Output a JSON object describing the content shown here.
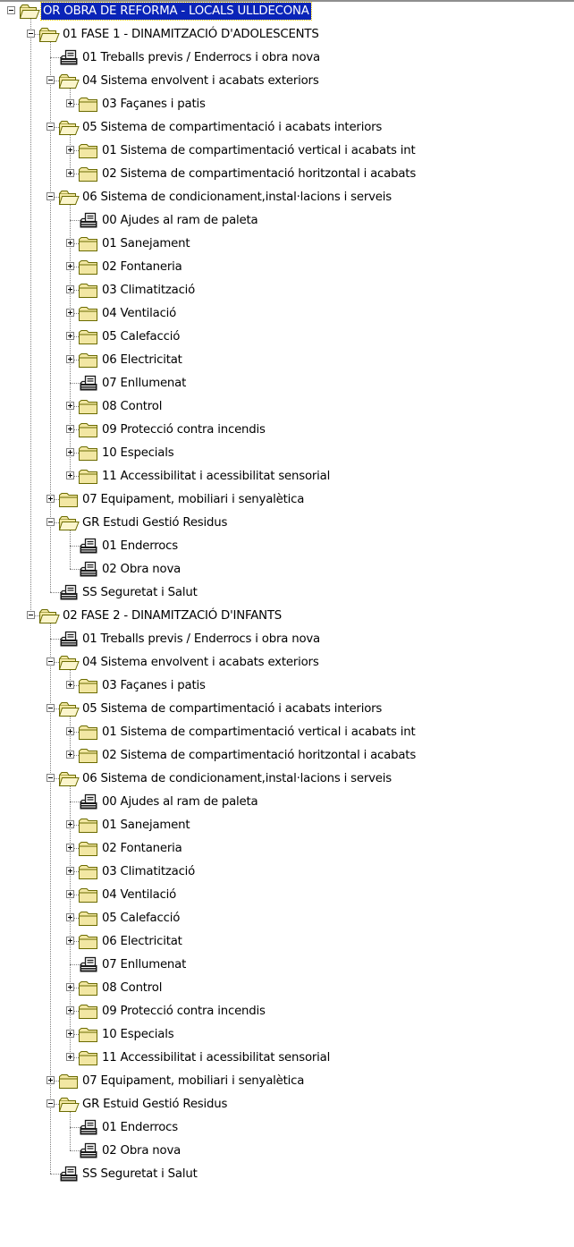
{
  "tree": {
    "root": {
      "label": "OR  OBRA DE REFORMA - LOCALS ULLDECONA"
    },
    "phases": [
      {
        "label": "01 FASE 1 - DINAMITZACIÓ D'ADOLESCENTS",
        "items": [
          {
            "label": "01 Treballs previs / Enderrocs i obra nova",
            "icon": "document-icon"
          },
          {
            "label": "04 Sistema envolvent i acabats exteriors",
            "icon": "folder-open-icon",
            "expanded": true,
            "children": [
              {
                "label": "03 Façanes i patis"
              }
            ]
          },
          {
            "label": "05 Sistema de compartimentació i acabats interiors",
            "icon": "folder-open-icon",
            "expanded": true,
            "children": [
              {
                "label": "01 Sistema de compartimentació vertical i acabats int"
              },
              {
                "label": "02 Sistema de compartimentació horitzontal i acabats"
              }
            ]
          },
          {
            "label": "06 Sistema de condicionament,instal·lacions i serveis",
            "icon": "folder-open-icon",
            "expanded": true,
            "children": [
              {
                "label": "00 Ajudes al ram de paleta",
                "leaf": true
              },
              {
                "label": "01 Sanejament"
              },
              {
                "label": "02 Fontaneria"
              },
              {
                "label": "03 Climatització"
              },
              {
                "label": "04 Ventilació"
              },
              {
                "label": "05 Calefacció"
              },
              {
                "label": "06 Electricitat"
              },
              {
                "label": "07 Enllumenat",
                "leaf": true
              },
              {
                "label": "08 Control"
              },
              {
                "label": "09 Protecció contra incendis"
              },
              {
                "label": "10 Especials"
              },
              {
                "label": "11 Accessibilitat i acessibilitat sensorial"
              }
            ]
          },
          {
            "label": "07 Equipament, mobiliari i senyalètica",
            "icon": "folder-closed-icon",
            "collapsed": true
          },
          {
            "label": "GR  Estudi Gestió Residus",
            "icon": "folder-open-icon",
            "expanded": true,
            "children": [
              {
                "label": "01 Enderrocs",
                "leaf": true
              },
              {
                "label": "02 Obra nova",
                "leaf": true
              }
            ]
          },
          {
            "label": "SS  Seguretat i Salut",
            "icon": "document-icon"
          }
        ]
      },
      {
        "label": "02 FASE 2 - DINAMITZACIÓ D'INFANTS",
        "items": [
          {
            "label": "01 Treballs previs / Enderrocs i obra nova",
            "icon": "document-icon"
          },
          {
            "label": "04 Sistema envolvent i acabats exteriors",
            "icon": "folder-open-icon",
            "expanded": true,
            "children": [
              {
                "label": "03 Façanes i patis"
              }
            ]
          },
          {
            "label": "05 Sistema de compartimentació i acabats interiors",
            "icon": "folder-open-icon",
            "expanded": true,
            "children": [
              {
                "label": "01 Sistema de compartimentació vertical i acabats int"
              },
              {
                "label": "02 Sistema de compartimentació horitzontal i acabats"
              }
            ]
          },
          {
            "label": "06 Sistema de condicionament,instal·lacions i serveis",
            "icon": "folder-open-icon",
            "expanded": true,
            "children": [
              {
                "label": "00 Ajudes al ram de paleta",
                "leaf": true
              },
              {
                "label": "01 Sanejament"
              },
              {
                "label": "02 Fontaneria"
              },
              {
                "label": "03 Climatització"
              },
              {
                "label": "04 Ventilació"
              },
              {
                "label": "05 Calefacció"
              },
              {
                "label": "06 Electricitat"
              },
              {
                "label": "07 Enllumenat",
                "leaf": true
              },
              {
                "label": "08 Control"
              },
              {
                "label": "09 Protecció contra incendis"
              },
              {
                "label": "10 Especials"
              },
              {
                "label": "11 Accessibilitat i acessibilitat sensorial"
              }
            ]
          },
          {
            "label": "07 Equipament, mobiliari i senyalètica",
            "icon": "folder-closed-icon",
            "collapsed": true
          },
          {
            "label": "GR  Estuid Gestió Residus",
            "icon": "folder-open-icon",
            "expanded": true,
            "children": [
              {
                "label": "01 Enderrocs",
                "leaf": true
              },
              {
                "label": "02 Obra nova",
                "leaf": true
              }
            ]
          },
          {
            "label": "SS  Seguretat i Salut",
            "icon": "document-icon"
          }
        ]
      }
    ]
  },
  "colors": {
    "selection": "#0a24b8",
    "folder_fill": "#f2e7a3",
    "folder_stroke": "#6b6b00",
    "document_dark": "#1a1a1a",
    "tree_lines": "#808080"
  }
}
